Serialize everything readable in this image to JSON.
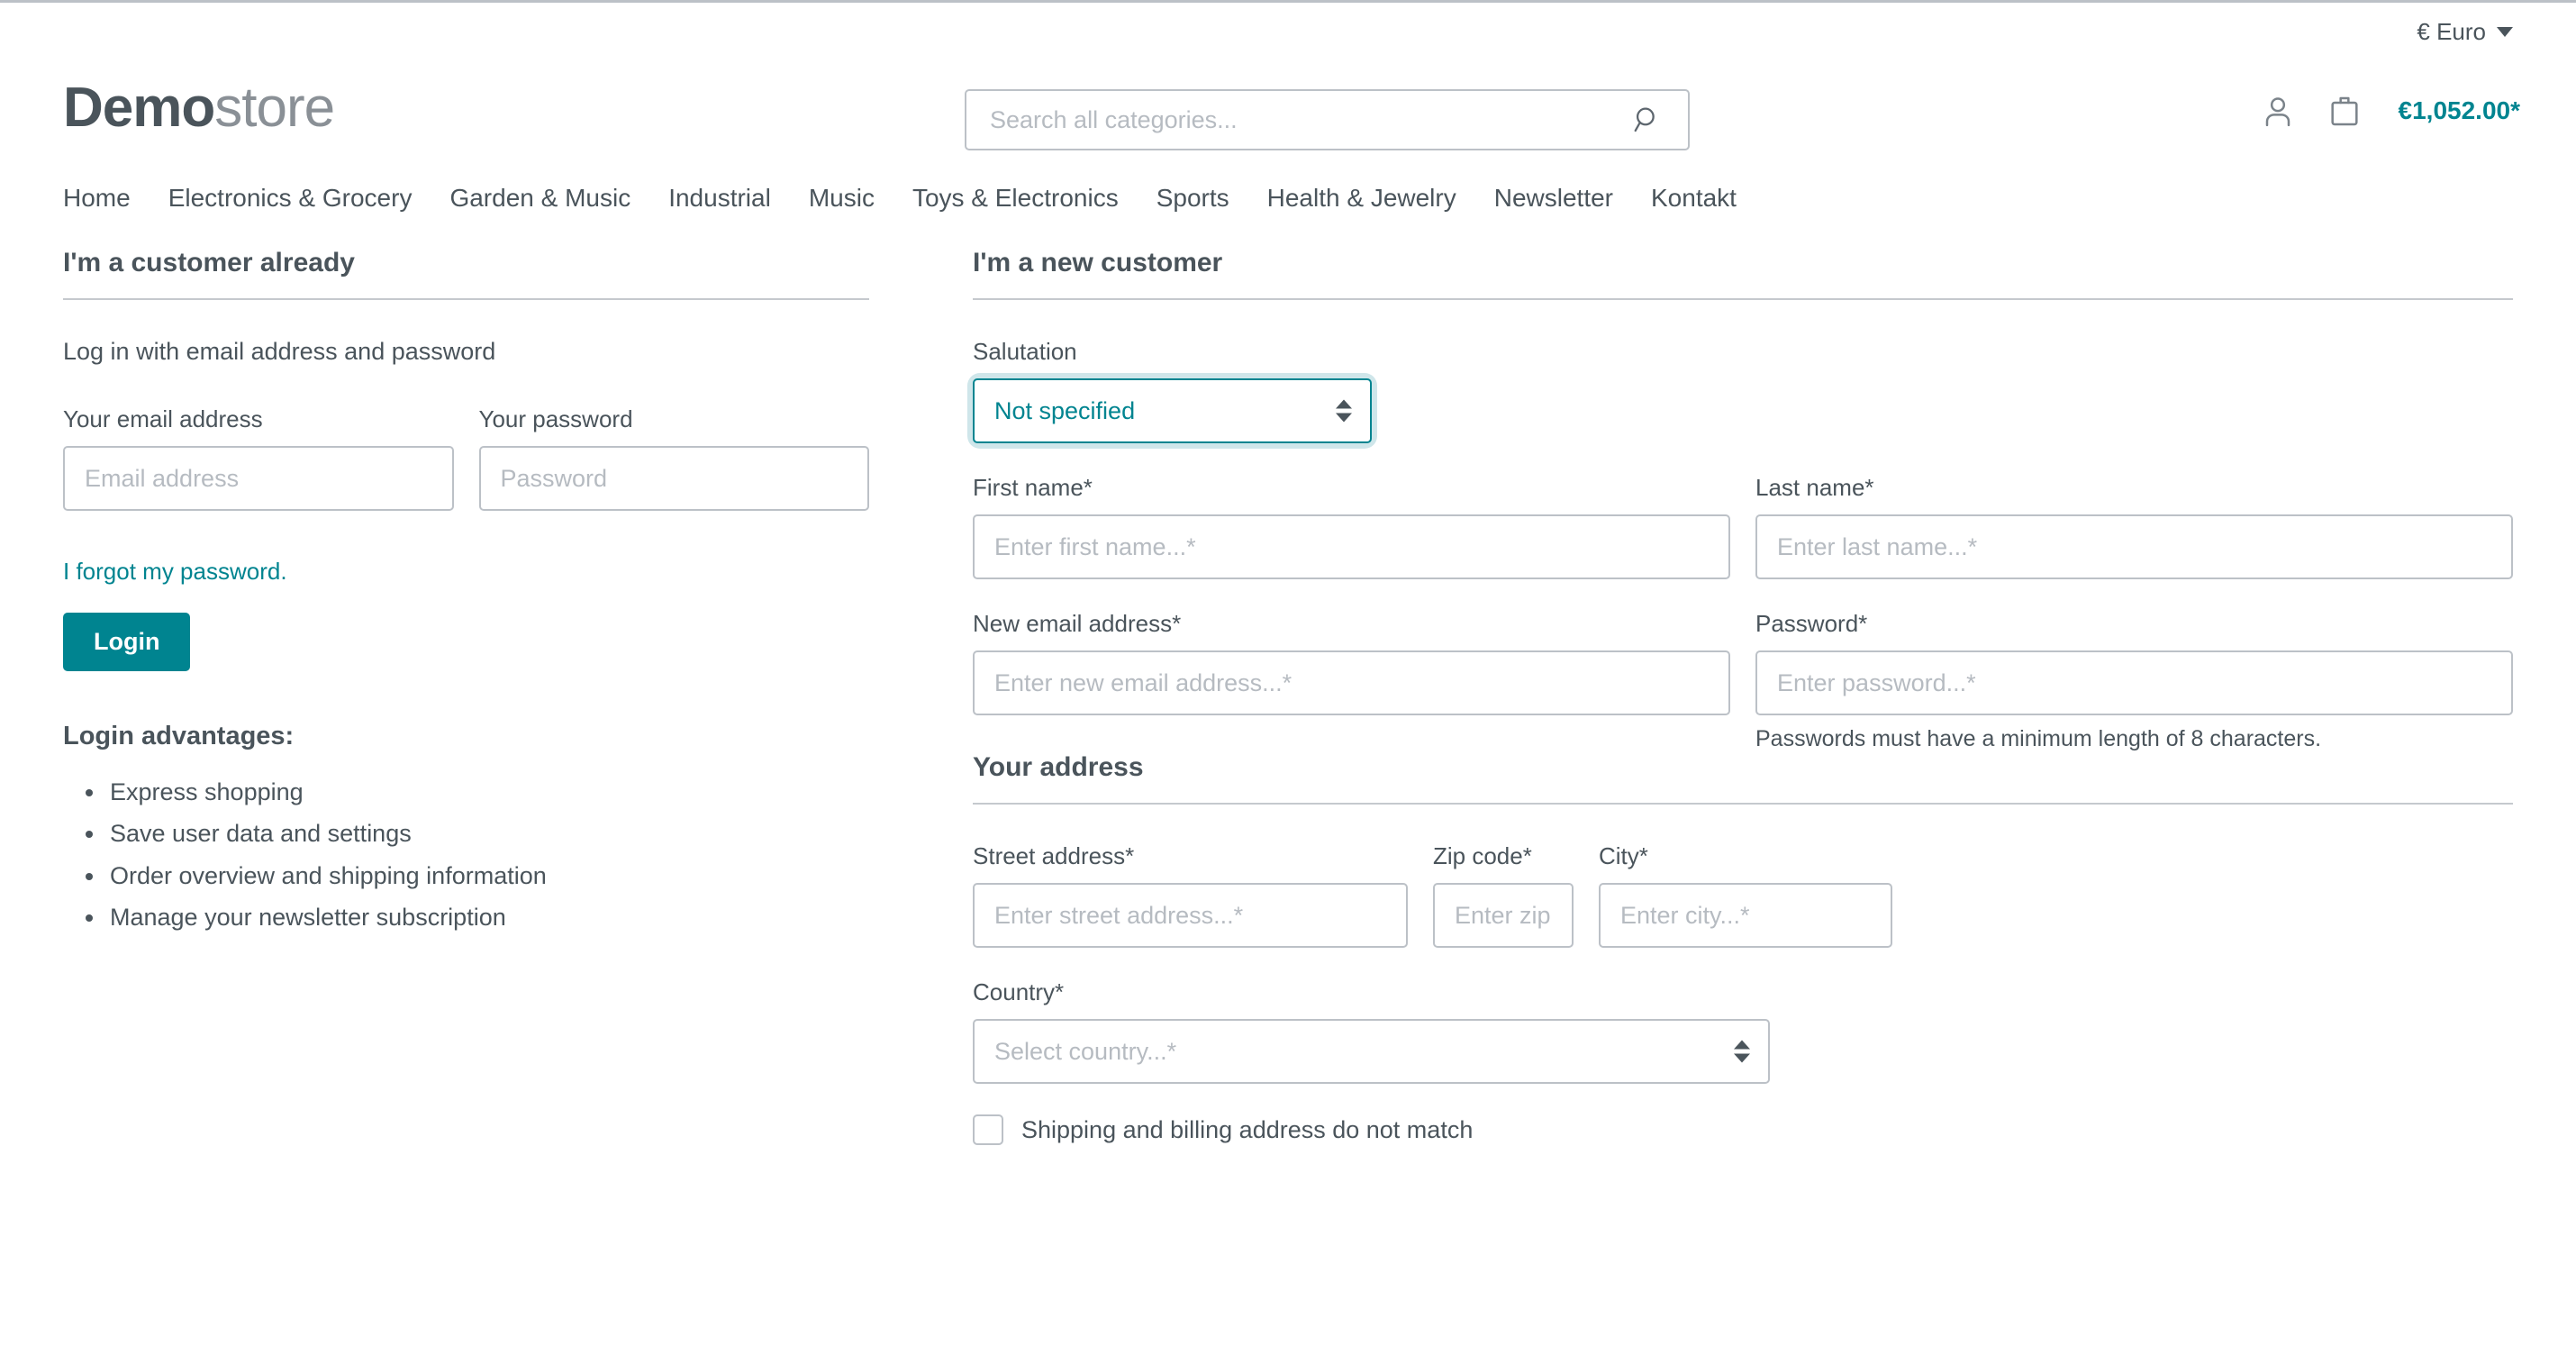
{
  "topbar": {
    "currency_label": "€ Euro",
    "currency_caret_icon": "chevron-down-icon"
  },
  "header": {
    "logo_bold": "Demo",
    "logo_light": "store",
    "search_placeholder": "Search all categories...",
    "search_value": "",
    "search_icon": "search-icon",
    "account_icon": "user-icon",
    "cart_icon": "shopping-bag-icon",
    "cart_total": "€1,052.00*",
    "accent_color": "#008490"
  },
  "nav": {
    "items": [
      {
        "label": "Home"
      },
      {
        "label": "Electronics & Grocery"
      },
      {
        "label": "Garden & Music"
      },
      {
        "label": "Industrial"
      },
      {
        "label": "Music"
      },
      {
        "label": "Toys & Electronics"
      },
      {
        "label": "Sports"
      },
      {
        "label": "Health & Jewelry"
      },
      {
        "label": "Newsletter"
      },
      {
        "label": "Kontakt"
      }
    ]
  },
  "login": {
    "heading": "I'm a customer already",
    "lead": "Log in with email address and password",
    "email_label": "Your email address",
    "email_placeholder": "Email address",
    "email_value": "",
    "password_label": "Your password",
    "password_placeholder": "Password",
    "password_value": "",
    "forgot_link": "I forgot my password.",
    "login_button": "Login",
    "advantages_title": "Login advantages:",
    "advantages": [
      "Express shopping",
      "Save user data and settings",
      "Order overview and shipping information",
      "Manage your newsletter subscription"
    ]
  },
  "register": {
    "heading": "I'm a new customer",
    "salutation_label": "Salutation",
    "salutation_value": "Not specified",
    "salutation_options": [
      "Not specified"
    ],
    "first_name_label": "First name*",
    "first_name_placeholder": "Enter first name...*",
    "first_name_value": "",
    "last_name_label": "Last name*",
    "last_name_placeholder": "Enter last name...*",
    "last_name_value": "",
    "new_email_label": "New email address*",
    "new_email_placeholder": "Enter new email address...*",
    "new_email_value": "",
    "password_label": "Password*",
    "password_placeholder": "Enter password...*",
    "password_value": "",
    "password_help": "Passwords must have a minimum length of 8 characters.",
    "address": {
      "heading": "Your address",
      "street_label": "Street address*",
      "street_placeholder": "Enter street address...*",
      "street_value": "",
      "zip_label": "Zip code*",
      "zip_placeholder": "Enter zip code...*",
      "zip_value": "",
      "city_label": "City*",
      "city_placeholder": "Enter city...*",
      "city_value": "",
      "country_label": "Country*",
      "country_value": "Select country...*",
      "country_options": [
        "Select country...*"
      ],
      "different_shipping_label": "Shipping and billing address do not match",
      "different_shipping_checked": false
    }
  }
}
